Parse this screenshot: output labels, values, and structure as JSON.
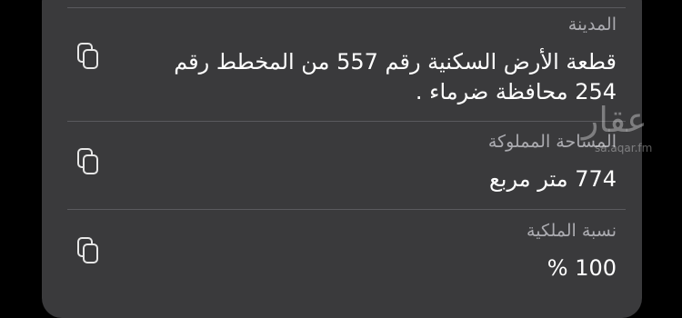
{
  "rows": [
    {
      "label": "المدينة",
      "value": "قطعة الأرض السكنية  رقم 557 من المخطط رقم 254  محافظة ضرماء ."
    },
    {
      "label": "المساحة المملوكة",
      "value": "774 متر مربع"
    },
    {
      "label": "نسبة الملكية",
      "value": "100 %"
    }
  ],
  "watermark": {
    "brand": "عقار",
    "url": "sa.aqar.fm"
  },
  "icons": {
    "copy": "copy-icon"
  }
}
